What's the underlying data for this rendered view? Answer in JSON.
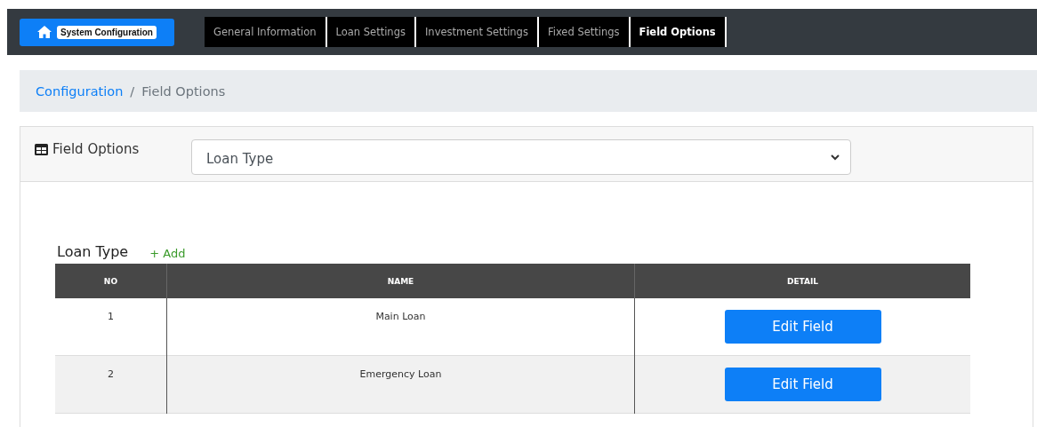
{
  "navbar": {
    "home_button": {
      "label": "System Configuration"
    },
    "tabs": [
      {
        "label": "General Information",
        "selected": false
      },
      {
        "label": "Loan Settings",
        "selected": false
      },
      {
        "label": "Investment Settings",
        "selected": false
      },
      {
        "label": "Fixed Settings",
        "selected": false
      },
      {
        "label": "Field Options",
        "selected": true
      }
    ]
  },
  "breadcrumb": [
    {
      "label": "Configuration",
      "link": true
    },
    {
      "label": "Field Options",
      "link": false
    }
  ],
  "breadcrumb_separator": "/",
  "card": {
    "title": "Field Options",
    "select": {
      "value": "Loan Type"
    },
    "section_title": "Loan Type",
    "add_label": "+ Add",
    "table": {
      "columns": [
        "NO",
        "NAME",
        "DETAIL"
      ],
      "rows": [
        {
          "no": "1",
          "name": "Main Loan",
          "action": "Edit Field"
        },
        {
          "no": "2",
          "name": "Emergency Loan",
          "action": "Edit Field"
        }
      ]
    }
  }
}
